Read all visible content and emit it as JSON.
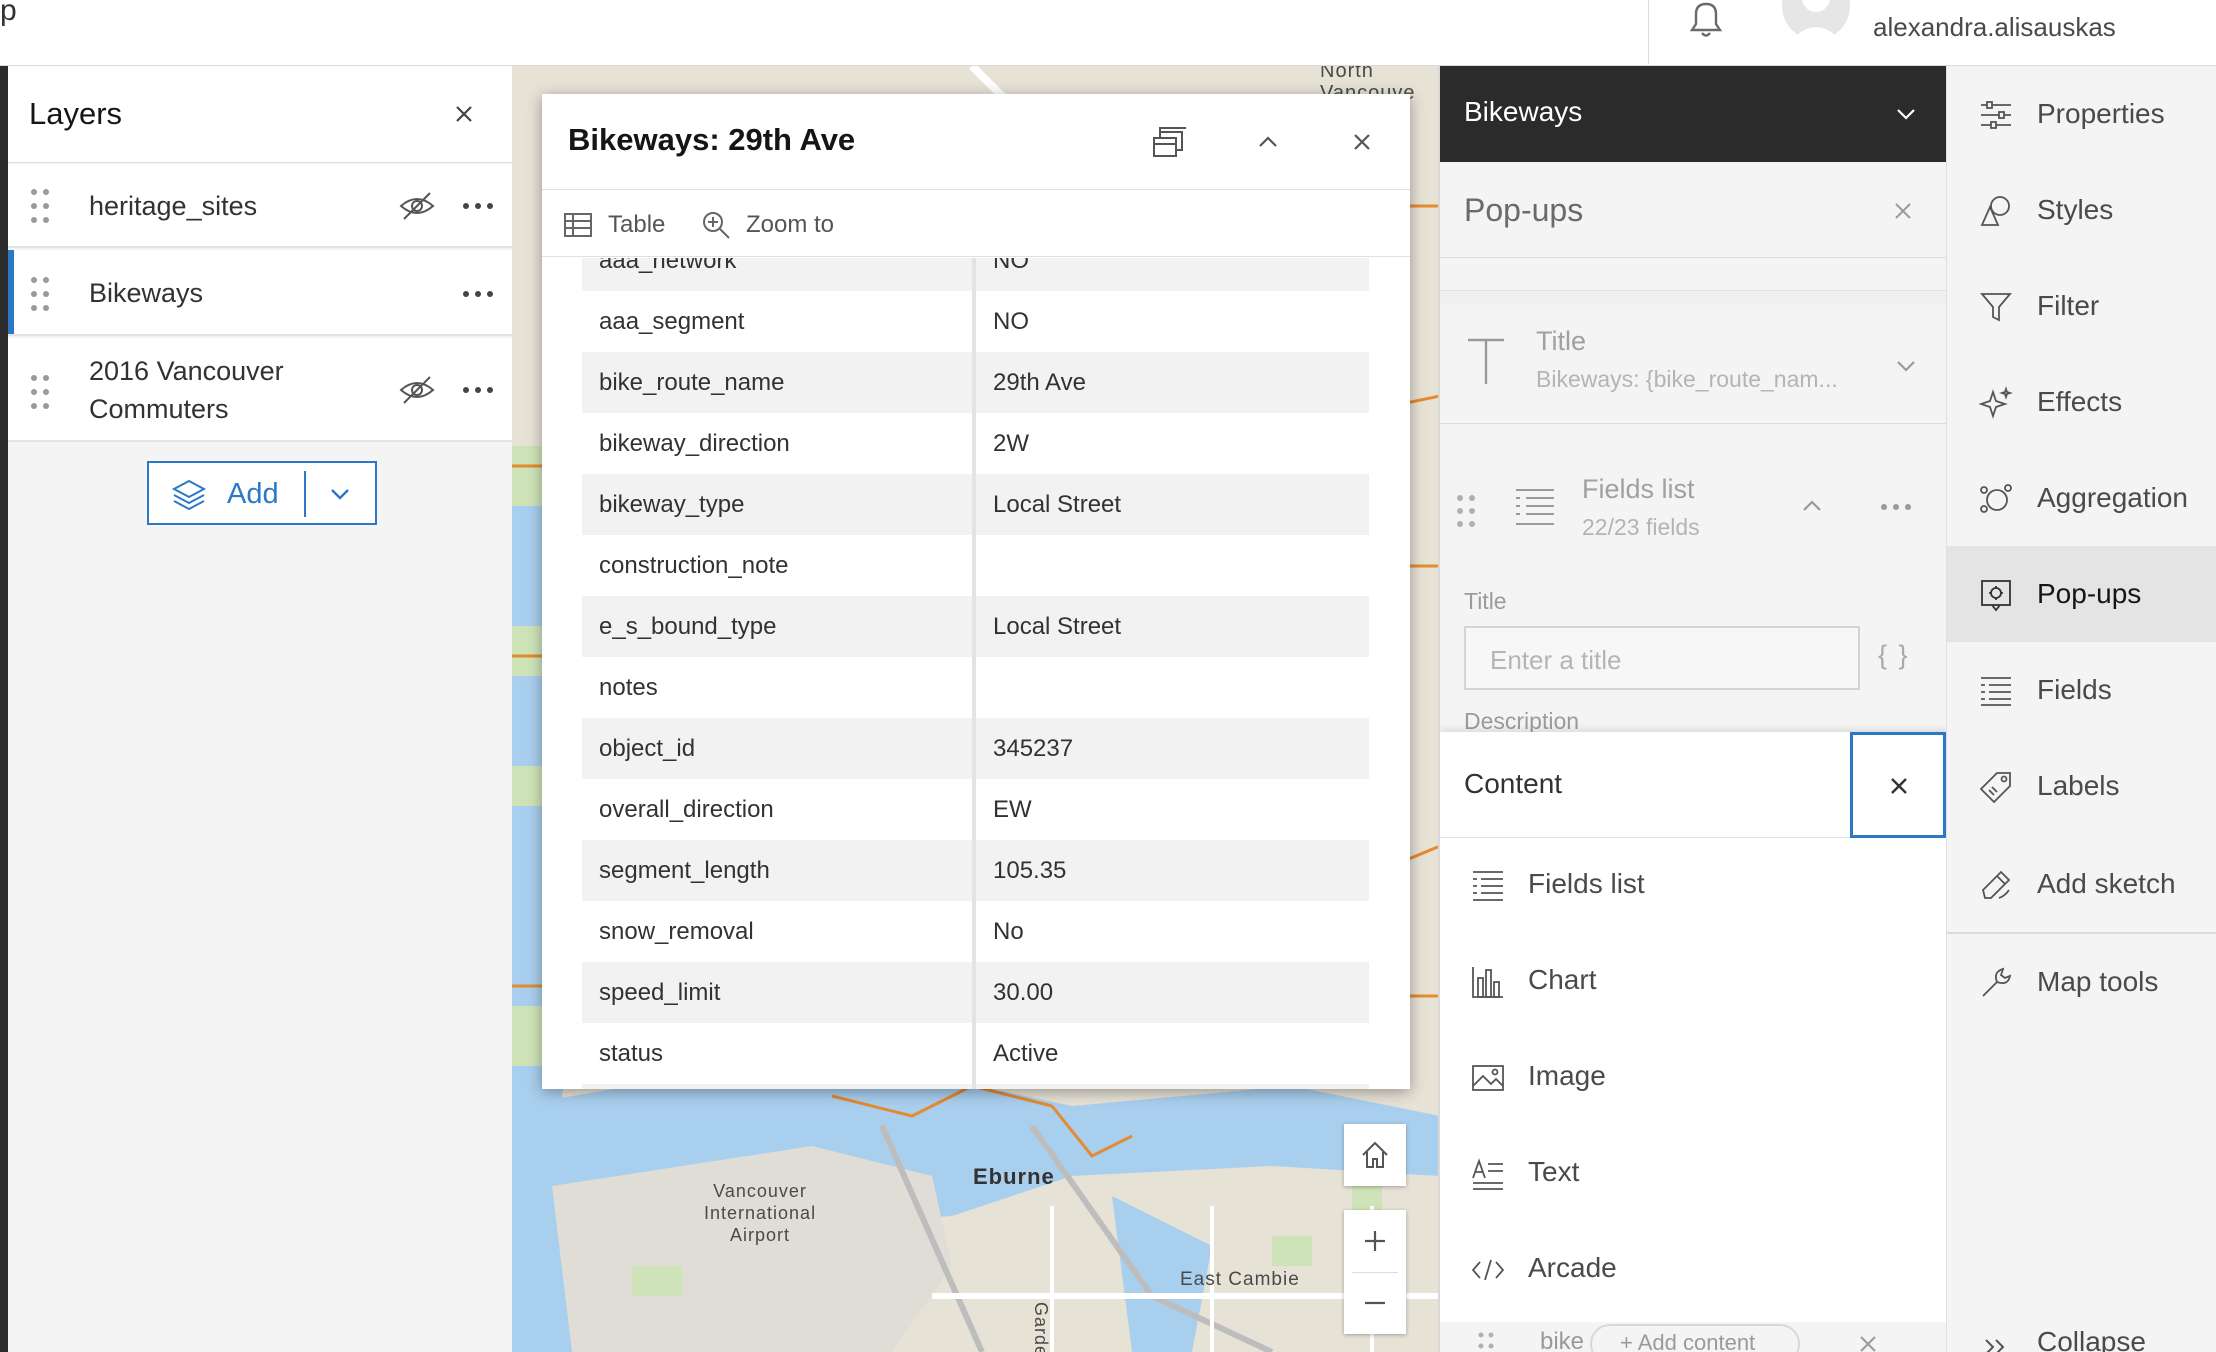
{
  "header": {
    "app_letter": "p",
    "username": "alexandra.alisauskas"
  },
  "colors": {
    "accent": "#2b79c5",
    "dark_bar": "#2b2b2b",
    "water": "#a9cfee",
    "map_land": "#e7e2d6",
    "road_orange": "#e58a2e"
  },
  "map": {
    "labels": {
      "north_van": "North\nVancouve",
      "eburne": "Eburne",
      "airport": "Vancouver\nInternational\nAirport",
      "east_cambie": "East Cambie",
      "garden": "Garden"
    }
  },
  "layers_panel": {
    "title": "Layers",
    "items": [
      {
        "name": "heritage_sites",
        "hidden": true,
        "selected": false
      },
      {
        "name": "Bikeways",
        "hidden": false,
        "selected": true
      },
      {
        "name": "2016 Vancouver\nCommuters",
        "hidden": true,
        "selected": false
      }
    ],
    "add_label": "Add"
  },
  "popup": {
    "title": "Bikeways: 29th Ave",
    "tools": {
      "table_label": "Table",
      "zoom_label": "Zoom to"
    },
    "attributes": [
      {
        "key": "aaa_network",
        "value": "NO"
      },
      {
        "key": "aaa_segment",
        "value": "NO"
      },
      {
        "key": "bike_route_name",
        "value": "29th Ave"
      },
      {
        "key": "bikeway_direction",
        "value": "2W"
      },
      {
        "key": "bikeway_type",
        "value": "Local Street"
      },
      {
        "key": "construction_note",
        "value": ""
      },
      {
        "key": "e_s_bound_type",
        "value": "Local Street"
      },
      {
        "key": "notes",
        "value": ""
      },
      {
        "key": "object_id",
        "value": "345237"
      },
      {
        "key": "overall_direction",
        "value": "EW"
      },
      {
        "key": "segment_length",
        "value": "105.35"
      },
      {
        "key": "snow_removal",
        "value": "No"
      },
      {
        "key": "speed_limit",
        "value": "30.00"
      },
      {
        "key": "status",
        "value": "Active"
      },
      {
        "key": "",
        "value": ""
      }
    ]
  },
  "config_panel": {
    "layer_name": "Bikeways",
    "title": "Pop-ups",
    "title_card": {
      "label": "Title",
      "value": "Bikeways: {bike_route_nam..."
    },
    "fields_card": {
      "label": "Fields list",
      "count": "22/23 fields",
      "title_label": "Title",
      "title_placeholder": "Enter a title",
      "braces": "{ }",
      "description_label": "Description"
    },
    "content_menu": {
      "title": "Content",
      "items": [
        {
          "label": "Fields list",
          "icon": "fields-list-icon"
        },
        {
          "label": "Chart",
          "icon": "chart-icon"
        },
        {
          "label": "Image",
          "icon": "image-icon"
        },
        {
          "label": "Text",
          "icon": "text-icon"
        },
        {
          "label": "Arcade",
          "icon": "arcade-icon"
        }
      ]
    },
    "bottom": {
      "text": "bike",
      "pill": "+ Add content"
    }
  },
  "action_bar": {
    "items": [
      {
        "label": "Properties",
        "icon": "properties-icon",
        "active": false
      },
      {
        "label": "Styles",
        "icon": "styles-icon",
        "active": false
      },
      {
        "label": "Filter",
        "icon": "filter-icon",
        "active": false
      },
      {
        "label": "Effects",
        "icon": "effects-icon",
        "active": false
      },
      {
        "label": "Aggregation",
        "icon": "aggregation-icon",
        "active": false
      },
      {
        "label": "Pop-ups",
        "icon": "popups-icon",
        "active": true
      },
      {
        "label": "Fields",
        "icon": "fields-icon",
        "active": false
      },
      {
        "label": "Labels",
        "icon": "labels-icon",
        "active": false
      },
      {
        "label": "Add sketch",
        "icon": "sketch-icon",
        "active": false
      },
      {
        "label": "Map tools",
        "icon": "map-tools-icon",
        "active": false
      }
    ],
    "collapse_label": "Collapse"
  }
}
